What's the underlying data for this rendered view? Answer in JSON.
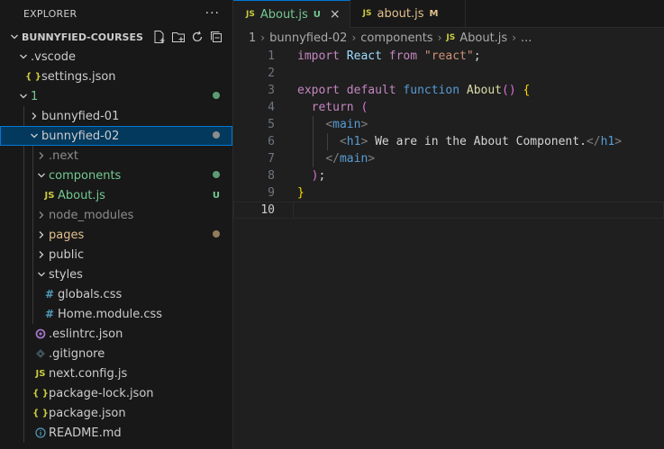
{
  "explorer": {
    "title": "EXPLORER",
    "more": "···",
    "root": "BUNNYFIED-COURSES",
    "items": [
      {
        "label": ".vscode"
      },
      {
        "label": "settings.json",
        "icon": "{ }"
      },
      {
        "label": "1"
      },
      {
        "label": "bunnyfied-01"
      },
      {
        "label": "bunnyfied-02"
      },
      {
        "label": ".next"
      },
      {
        "label": "components"
      },
      {
        "label": "About.js",
        "icon": "JS",
        "badge": "U"
      },
      {
        "label": "node_modules"
      },
      {
        "label": "pages"
      },
      {
        "label": "public"
      },
      {
        "label": "styles"
      },
      {
        "label": "globals.css",
        "icon": "#"
      },
      {
        "label": "Home.module.css",
        "icon": "#"
      },
      {
        "label": ".eslintrc.json"
      },
      {
        "label": ".gitignore"
      },
      {
        "label": "next.config.js",
        "icon": "JS"
      },
      {
        "label": "package-lock.json",
        "icon": "{ }"
      },
      {
        "label": "package.json",
        "icon": "{ }"
      },
      {
        "label": "README.md"
      }
    ]
  },
  "tabs": [
    {
      "icon": "JS",
      "label": "About.js",
      "badge": "U",
      "close": "×"
    },
    {
      "icon": "JS",
      "label": "about.js",
      "badge": "M"
    }
  ],
  "breadcrumbs": [
    "1",
    "bunnyfied-02",
    "components",
    "About.js",
    "..."
  ],
  "breadcrumb_icon": "JS",
  "editor": {
    "line_numbers": [
      "1",
      "2",
      "3",
      "4",
      "5",
      "6",
      "7",
      "8",
      "9",
      "10"
    ],
    "tokens": {
      "l1_import": "import",
      "l1_react": "React",
      "l1_from": "from",
      "l1_str": "\"react\"",
      "l1_semi": ";",
      "l3_export": "export",
      "l3_default": "default",
      "l3_function": "function",
      "l3_name": "About",
      "l3_parens": "()",
      "l3_brace": "{",
      "l4_return": "return",
      "l4_paren": "(",
      "l5_open": "<",
      "l5_tag": "main",
      "l5_close": ">",
      "l6_open": "<",
      "l6_tag": "h1",
      "l6_close": ">",
      "l6_text": " We are in the About Component.",
      "l6_end_open": "</",
      "l6_end_tag": "h1",
      "l6_end_close": ">",
      "l7_open": "</",
      "l7_tag": "main",
      "l7_close": ">",
      "l8_paren": ")",
      "l8_semi": ";",
      "l9_brace": "}"
    }
  },
  "colors": {
    "modified": "#e2c08d",
    "untracked": "#73c991",
    "accent": "#0078d4",
    "js_icon": "#cbcb41",
    "json_icon": "#cbcb41",
    "css_icon": "#519aba"
  }
}
